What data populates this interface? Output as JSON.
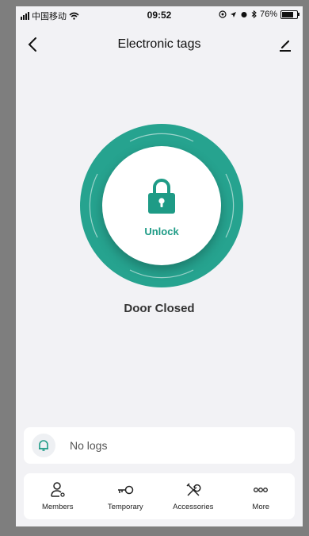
{
  "status_bar": {
    "carrier": "中国移动",
    "time": "09:52",
    "battery": "76%"
  },
  "nav": {
    "title": "Electronic tags"
  },
  "lock": {
    "action_label": "Unlock",
    "door_status": "Door Closed",
    "accent_color": "#26a38f"
  },
  "logs": {
    "text": "No logs"
  },
  "tabs": [
    {
      "label": "Members",
      "icon": "members-icon"
    },
    {
      "label": "Temporary",
      "icon": "key-icon"
    },
    {
      "label": "Accessories",
      "icon": "tools-icon"
    },
    {
      "label": "More",
      "icon": "more-icon"
    }
  ]
}
